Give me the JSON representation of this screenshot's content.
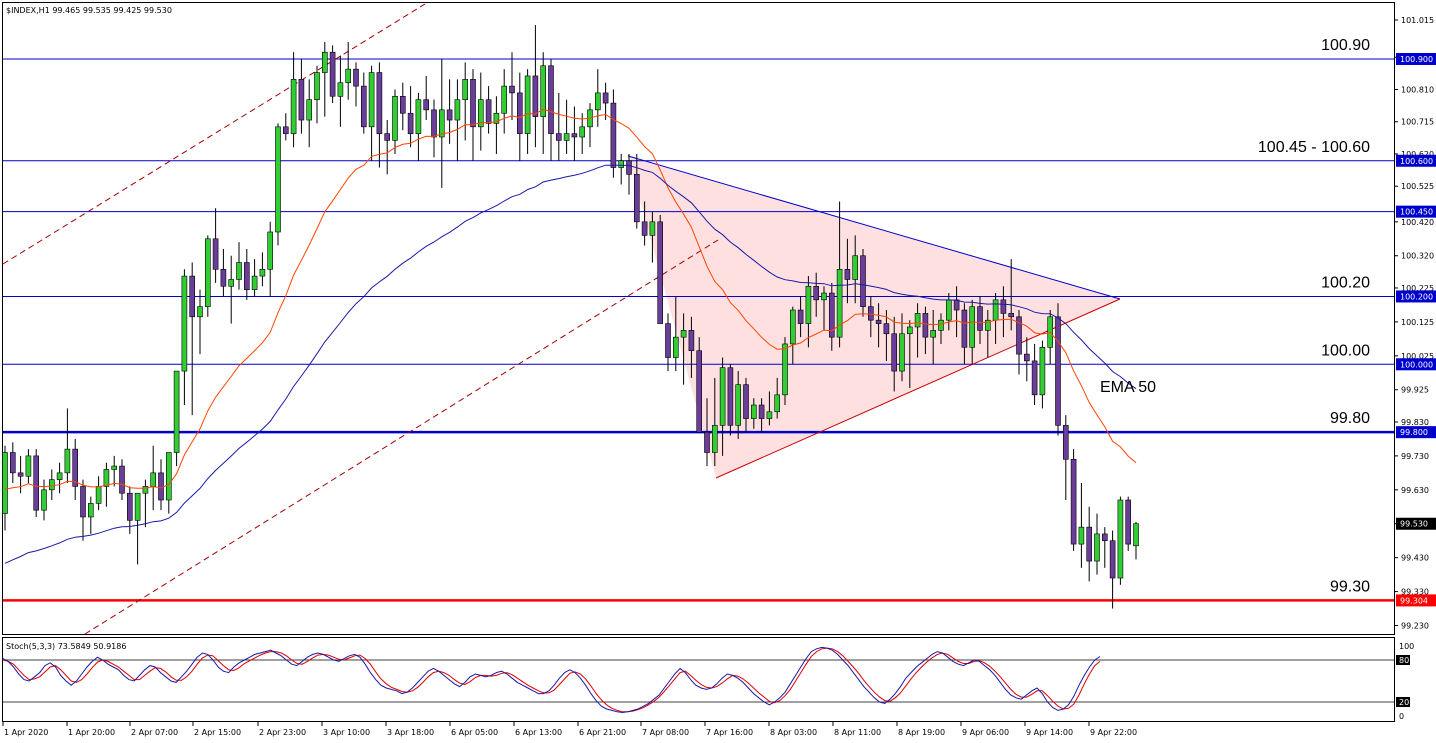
{
  "chart_data": {
    "type": "candlestick",
    "header": "$INDEX,H1  99.465 99.535 99.425 99.530",
    "y_range": [
      99.205,
      101.065
    ],
    "y_ticks": [
      "101.015",
      "100.905",
      "100.810",
      "100.715",
      "100.620",
      "100.525",
      "100.420",
      "100.320",
      "100.225",
      "100.125",
      "100.025",
      "99.925",
      "99.830",
      "99.730",
      "99.630",
      "99.530",
      "99.430",
      "99.330",
      "99.230"
    ],
    "x_ticks": [
      "1 Apr 2020",
      "1 Apr 20:00",
      "2 Apr 07:00",
      "2 Apr 15:00",
      "2 Apr 23:00",
      "3 Apr 10:00",
      "3 Apr 18:00",
      "6 Apr 05:00",
      "6 Apr 13:00",
      "6 Apr 21:00",
      "7 Apr 08:00",
      "7 Apr 16:00",
      "8 Apr 03:00",
      "8 Apr 11:00",
      "8 Apr 19:00",
      "9 Apr 06:00",
      "9 Apr 14:00",
      "9 Apr 22:00"
    ],
    "levels": [
      {
        "label": "100.90",
        "tag": "100.900",
        "value": 100.9,
        "color": "#0000cc"
      },
      {
        "label": "100.45 - 100.60",
        "tag": "100.600",
        "value": 100.6,
        "color": "#0000cc"
      },
      {
        "label": "",
        "tag": "100.450",
        "value": 100.45,
        "color": "#0000cc"
      },
      {
        "label": "100.20",
        "tag": "100.200",
        "value": 100.2,
        "color": "#0000cc"
      },
      {
        "label": "100.00",
        "tag": "100.000",
        "value": 100.0,
        "color": "#0000cc"
      },
      {
        "label": "99.80",
        "tag": "99.800",
        "value": 99.8,
        "color": "#0000cc"
      },
      {
        "label": "99.30",
        "tag": "99.304",
        "value": 99.304,
        "color": "#ff0000"
      }
    ],
    "price_tag": {
      "text": "99.530",
      "value": 99.53
    },
    "ema_label": "EMA 50",
    "candles": [
      [
        99.56,
        99.76,
        99.51,
        99.74
      ],
      [
        99.74,
        99.77,
        99.65,
        99.68
      ],
      [
        99.68,
        99.73,
        99.62,
        99.67
      ],
      [
        99.67,
        99.75,
        99.65,
        99.73
      ],
      [
        99.73,
        99.75,
        99.55,
        99.57
      ],
      [
        99.57,
        99.66,
        99.54,
        99.63
      ],
      [
        99.63,
        99.69,
        99.6,
        99.66
      ],
      [
        99.66,
        99.71,
        99.62,
        99.68
      ],
      [
        99.68,
        99.87,
        99.65,
        99.75
      ],
      [
        99.75,
        99.78,
        99.6,
        99.64
      ],
      [
        99.64,
        99.66,
        99.48,
        99.55
      ],
      [
        99.55,
        99.61,
        99.5,
        99.59
      ],
      [
        99.59,
        99.67,
        99.57,
        99.64
      ],
      [
        99.64,
        99.71,
        99.58,
        99.69
      ],
      [
        99.69,
        99.73,
        99.64,
        99.7
      ],
      [
        99.7,
        99.72,
        99.6,
        99.62
      ],
      [
        99.62,
        99.64,
        99.5,
        99.54
      ],
      [
        99.54,
        99.62,
        99.41,
        99.62
      ],
      [
        99.62,
        99.66,
        99.52,
        99.64
      ],
      [
        99.64,
        99.76,
        99.57,
        99.68
      ],
      [
        99.68,
        99.72,
        99.57,
        99.6
      ],
      [
        99.6,
        99.74,
        99.56,
        99.74
      ],
      [
        99.74,
        99.88,
        99.7,
        99.98
      ],
      [
        99.98,
        100.28,
        99.88,
        100.26
      ],
      [
        100.26,
        100.3,
        99.85,
        100.14
      ],
      [
        100.14,
        100.22,
        100.03,
        100.17
      ],
      [
        100.17,
        100.38,
        100.14,
        100.37
      ],
      [
        100.37,
        100.46,
        100.24,
        100.28
      ],
      [
        100.28,
        100.34,
        100.2,
        100.23
      ],
      [
        100.23,
        100.32,
        100.12,
        100.25
      ],
      [
        100.25,
        100.36,
        100.22,
        100.3
      ],
      [
        100.3,
        100.34,
        100.19,
        100.22
      ],
      [
        100.22,
        100.31,
        100.2,
        100.26
      ],
      [
        100.26,
        100.33,
        100.23,
        100.28
      ],
      [
        100.28,
        100.42,
        100.2,
        100.39
      ],
      [
        100.39,
        100.71,
        100.35,
        100.7
      ],
      [
        100.7,
        100.74,
        100.66,
        100.68
      ],
      [
        100.68,
        100.92,
        100.64,
        100.84
      ],
      [
        100.84,
        100.9,
        100.68,
        100.72
      ],
      [
        100.72,
        100.84,
        100.64,
        100.78
      ],
      [
        100.78,
        100.88,
        100.71,
        100.86
      ],
      [
        100.86,
        100.95,
        100.73,
        100.92
      ],
      [
        100.92,
        100.94,
        100.77,
        100.79
      ],
      [
        100.79,
        100.91,
        100.7,
        100.83
      ],
      [
        100.83,
        100.95,
        100.78,
        100.87
      ],
      [
        100.87,
        100.89,
        100.76,
        100.82
      ],
      [
        100.82,
        100.86,
        100.68,
        100.7
      ],
      [
        100.7,
        100.88,
        100.6,
        100.86
      ],
      [
        100.86,
        100.89,
        100.58,
        100.68
      ],
      [
        100.68,
        100.72,
        100.56,
        100.66
      ],
      [
        100.66,
        100.81,
        100.62,
        100.79
      ],
      [
        100.79,
        100.83,
        100.69,
        100.74
      ],
      [
        100.74,
        100.82,
        100.64,
        100.68
      ],
      [
        100.68,
        100.8,
        100.6,
        100.78
      ],
      [
        100.78,
        100.85,
        100.72,
        100.75
      ],
      [
        100.75,
        100.78,
        100.61,
        100.67
      ],
      [
        100.67,
        100.9,
        100.52,
        100.75
      ],
      [
        100.75,
        100.84,
        100.65,
        100.72
      ],
      [
        100.72,
        100.84,
        100.6,
        100.78
      ],
      [
        100.78,
        100.89,
        100.66,
        100.84
      ],
      [
        100.84,
        100.87,
        100.6,
        100.7
      ],
      [
        100.7,
        100.86,
        100.63,
        100.78
      ],
      [
        100.78,
        100.82,
        100.68,
        100.71
      ],
      [
        100.71,
        100.79,
        100.62,
        100.74
      ],
      [
        100.74,
        100.87,
        100.68,
        100.82
      ],
      [
        100.82,
        100.92,
        100.72,
        100.8
      ],
      [
        100.8,
        100.86,
        100.6,
        100.68
      ],
      [
        100.68,
        100.87,
        100.62,
        100.85
      ],
      [
        100.85,
        101.0,
        100.64,
        100.73
      ],
      [
        100.73,
        100.92,
        100.62,
        100.88
      ],
      [
        100.88,
        100.9,
        100.6,
        100.68
      ],
      [
        100.68,
        100.8,
        100.6,
        100.66
      ],
      [
        100.66,
        100.78,
        100.62,
        100.68
      ],
      [
        100.68,
        100.76,
        100.6,
        100.67
      ],
      [
        100.67,
        100.74,
        100.62,
        100.7
      ],
      [
        100.7,
        100.77,
        100.64,
        100.75
      ],
      [
        100.75,
        100.87,
        100.7,
        100.8
      ],
      [
        100.8,
        100.83,
        100.72,
        100.77
      ],
      [
        100.77,
        100.81,
        100.55,
        100.58
      ],
      [
        100.58,
        100.62,
        100.53,
        100.6
      ],
      [
        100.6,
        100.62,
        100.5,
        100.56
      ],
      [
        100.56,
        100.62,
        100.4,
        100.42
      ],
      [
        100.42,
        100.48,
        100.35,
        100.38
      ],
      [
        100.38,
        100.45,
        100.3,
        100.42
      ],
      [
        100.42,
        100.44,
        100.2,
        100.12
      ],
      [
        100.12,
        100.15,
        99.98,
        100.02
      ],
      [
        100.02,
        100.2,
        99.98,
        100.08
      ],
      [
        100.08,
        100.15,
        99.94,
        100.1
      ],
      [
        100.1,
        100.14,
        99.96,
        100.04
      ],
      [
        100.04,
        100.08,
        99.8,
        99.8
      ],
      [
        99.8,
        99.9,
        99.7,
        99.74
      ],
      [
        99.74,
        99.96,
        99.7,
        99.82
      ],
      [
        99.82,
        100.02,
        99.73,
        99.99
      ],
      [
        99.99,
        100.0,
        99.79,
        99.82
      ],
      [
        99.82,
        99.98,
        99.78,
        99.94
      ],
      [
        99.94,
        99.96,
        99.8,
        99.84
      ],
      [
        99.84,
        99.9,
        99.81,
        99.88
      ],
      [
        99.88,
        99.9,
        99.8,
        99.84
      ],
      [
        99.84,
        99.92,
        99.82,
        99.86
      ],
      [
        99.86,
        99.96,
        99.84,
        99.91
      ],
      [
        99.91,
        100.08,
        99.88,
        100.06
      ],
      [
        100.06,
        100.17,
        100.0,
        100.16
      ],
      [
        100.16,
        100.2,
        100.08,
        100.12
      ],
      [
        100.12,
        100.26,
        100.05,
        100.23
      ],
      [
        100.23,
        100.27,
        100.14,
        100.19
      ],
      [
        100.19,
        100.23,
        100.1,
        100.21
      ],
      [
        100.21,
        100.24,
        100.04,
        100.08
      ],
      [
        100.08,
        100.48,
        100.05,
        100.28
      ],
      [
        100.28,
        100.37,
        100.18,
        100.25
      ],
      [
        100.25,
        100.38,
        100.18,
        100.32
      ],
      [
        100.32,
        100.34,
        100.14,
        100.17
      ],
      [
        100.17,
        100.2,
        100.08,
        100.13
      ],
      [
        100.13,
        100.18,
        100.05,
        100.12
      ],
      [
        100.12,
        100.16,
        100.01,
        100.09
      ],
      [
        100.09,
        100.14,
        99.92,
        99.98
      ],
      [
        99.98,
        100.15,
        99.95,
        100.09
      ],
      [
        100.09,
        100.13,
        99.93,
        100.11
      ],
      [
        100.11,
        100.18,
        100.02,
        100.15
      ],
      [
        100.15,
        100.17,
        100.03,
        100.08
      ],
      [
        100.08,
        100.16,
        100.0,
        100.1
      ],
      [
        100.1,
        100.15,
        100.06,
        100.13
      ],
      [
        100.13,
        100.21,
        100.1,
        100.19
      ],
      [
        100.19,
        100.23,
        100.08,
        100.16
      ],
      [
        100.16,
        100.18,
        100.0,
        100.05
      ],
      [
        100.05,
        100.19,
        100.0,
        100.17
      ],
      [
        100.17,
        100.2,
        100.06,
        100.1
      ],
      [
        100.1,
        100.16,
        100.02,
        100.13
      ],
      [
        100.13,
        100.21,
        100.06,
        100.19
      ],
      [
        100.19,
        100.23,
        100.08,
        100.15
      ],
      [
        100.15,
        100.31,
        100.1,
        100.14
      ],
      [
        100.14,
        100.16,
        99.97,
        100.03
      ],
      [
        100.03,
        100.08,
        99.95,
        100.01
      ],
      [
        100.01,
        100.06,
        99.88,
        99.91
      ],
      [
        99.91,
        100.07,
        99.87,
        100.05
      ],
      [
        100.05,
        100.16,
        100.0,
        100.14
      ],
      [
        100.14,
        100.18,
        99.79,
        99.82
      ],
      [
        99.82,
        99.85,
        99.6,
        99.72
      ],
      [
        99.72,
        99.75,
        99.45,
        99.47
      ],
      [
        99.47,
        99.65,
        99.4,
        99.52
      ],
      [
        99.52,
        99.58,
        99.36,
        99.42
      ],
      [
        99.42,
        99.56,
        99.38,
        99.5
      ],
      [
        99.5,
        99.52,
        99.4,
        99.48
      ],
      [
        99.48,
        99.51,
        99.28,
        99.37
      ],
      [
        99.37,
        99.61,
        99.35,
        99.6
      ],
      [
        99.6,
        99.61,
        99.45,
        99.47
      ],
      [
        99.465,
        99.535,
        99.425,
        99.53
      ]
    ],
    "stoch": {
      "label": "Stoch(5,3,3) 73.5849 50.9186",
      "levels": [
        "100",
        "80",
        "20",
        "0"
      ],
      "main": [
        82,
        78,
        70,
        60,
        52,
        50,
        56,
        62,
        72,
        76,
        70,
        58,
        50,
        44,
        50,
        60,
        70,
        78,
        84,
        80,
        74,
        70,
        66,
        58,
        52,
        50,
        58,
        66,
        72,
        70,
        62,
        56,
        50,
        48,
        56,
        64,
        74,
        84,
        90,
        88,
        80,
        70,
        64,
        62,
        70,
        76,
        80,
        84,
        88,
        90,
        92,
        94,
        90,
        86,
        80,
        74,
        72,
        78,
        84,
        88,
        90,
        88,
        84,
        80,
        78,
        82,
        86,
        88,
        84,
        74,
        62,
        52,
        44,
        40,
        38,
        36,
        32,
        34,
        40,
        48,
        56,
        64,
        68,
        64,
        58,
        52,
        46,
        42,
        48,
        56,
        60,
        58,
        56,
        58,
        62,
        64,
        60,
        54,
        48,
        44,
        40,
        36,
        32,
        32,
        36,
        44,
        54,
        62,
        66,
        62,
        54,
        44,
        32,
        22,
        14,
        10,
        8,
        6,
        5,
        6,
        8,
        10,
        14,
        18,
        24,
        30,
        40,
        50,
        60,
        68,
        62,
        52,
        44,
        40,
        38,
        40,
        46,
        54,
        60,
        58,
        54,
        48,
        40,
        32,
        26,
        20,
        16,
        20,
        26,
        34,
        46,
        58,
        70,
        82,
        92,
        96,
        98,
        97,
        94,
        88,
        80,
        72,
        62,
        52,
        42,
        34,
        26,
        20,
        18,
        24,
        32,
        42,
        54,
        62,
        70,
        76,
        82,
        88,
        92,
        90,
        84,
        78,
        74,
        72,
        76,
        80,
        78,
        72,
        66,
        58,
        48,
        38,
        30,
        26,
        24,
        30,
        36,
        40,
        32,
        20,
        12,
        8,
        10,
        16,
        28,
        44,
        58,
        70,
        80,
        85
      ],
      "signal": [
        80,
        78,
        74,
        66,
        58,
        52,
        53,
        56,
        63,
        70,
        72,
        66,
        58,
        50,
        48,
        52,
        60,
        69,
        77,
        80,
        78,
        74,
        70,
        64,
        58,
        52,
        52,
        58,
        64,
        69,
        68,
        63,
        56,
        51,
        51,
        56,
        64,
        74,
        83,
        87,
        86,
        79,
        72,
        66,
        65,
        69,
        75,
        79,
        83,
        87,
        90,
        92,
        92,
        90,
        86,
        80,
        75,
        74,
        78,
        83,
        87,
        88,
        87,
        84,
        81,
        80,
        83,
        86,
        87,
        82,
        74,
        63,
        53,
        46,
        41,
        38,
        35,
        34,
        36,
        41,
        48,
        56,
        62,
        64,
        62,
        58,
        52,
        47,
        45,
        49,
        55,
        58,
        58,
        57,
        58,
        61,
        62,
        59,
        54,
        49,
        44,
        40,
        36,
        33,
        33,
        37,
        45,
        53,
        61,
        63,
        60,
        53,
        43,
        32,
        23,
        16,
        11,
        8,
        6,
        6,
        7,
        9,
        12,
        16,
        21,
        27,
        35,
        44,
        53,
        62,
        64,
        58,
        51,
        45,
        41,
        40,
        42,
        47,
        53,
        58,
        57,
        53,
        47,
        40,
        33,
        27,
        21,
        19,
        22,
        29,
        38,
        50,
        62,
        74,
        85,
        92,
        96,
        97,
        96,
        92,
        86,
        78,
        70,
        61,
        51,
        42,
        34,
        27,
        22,
        21,
        26,
        33,
        43,
        53,
        62,
        70,
        77,
        83,
        88,
        90,
        88,
        83,
        78,
        75,
        75,
        78,
        79,
        76,
        71,
        64,
        56,
        47,
        38,
        31,
        27,
        27,
        31,
        36,
        36,
        29,
        21,
        14,
        10,
        11,
        17,
        30,
        46,
        60,
        72,
        78
      ]
    }
  }
}
